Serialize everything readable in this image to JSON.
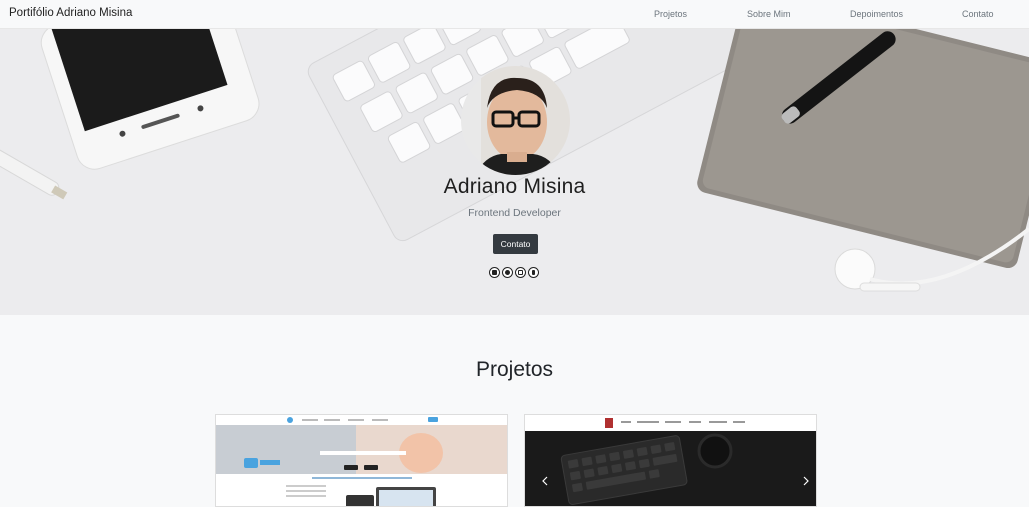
{
  "navbar": {
    "brand": "Portifólio Adriano Misina",
    "items": [
      {
        "label": "Projetos"
      },
      {
        "label": "Sobre Mim"
      },
      {
        "label": "Depoimentos"
      },
      {
        "label": "Contato"
      }
    ]
  },
  "hero": {
    "name": "Adriano Misina",
    "role": "Frontend Developer",
    "contact_button": "Contato",
    "socials": [
      {
        "icon": "linkedin-icon"
      },
      {
        "icon": "github-icon"
      },
      {
        "icon": "instagram-icon"
      },
      {
        "icon": "facebook-icon"
      }
    ]
  },
  "projects": {
    "title": "Projetos"
  },
  "colors": {
    "navbar_bg": "#f8f9fa",
    "button_bg": "#343a40",
    "page_bg": "#f8f9fa"
  }
}
